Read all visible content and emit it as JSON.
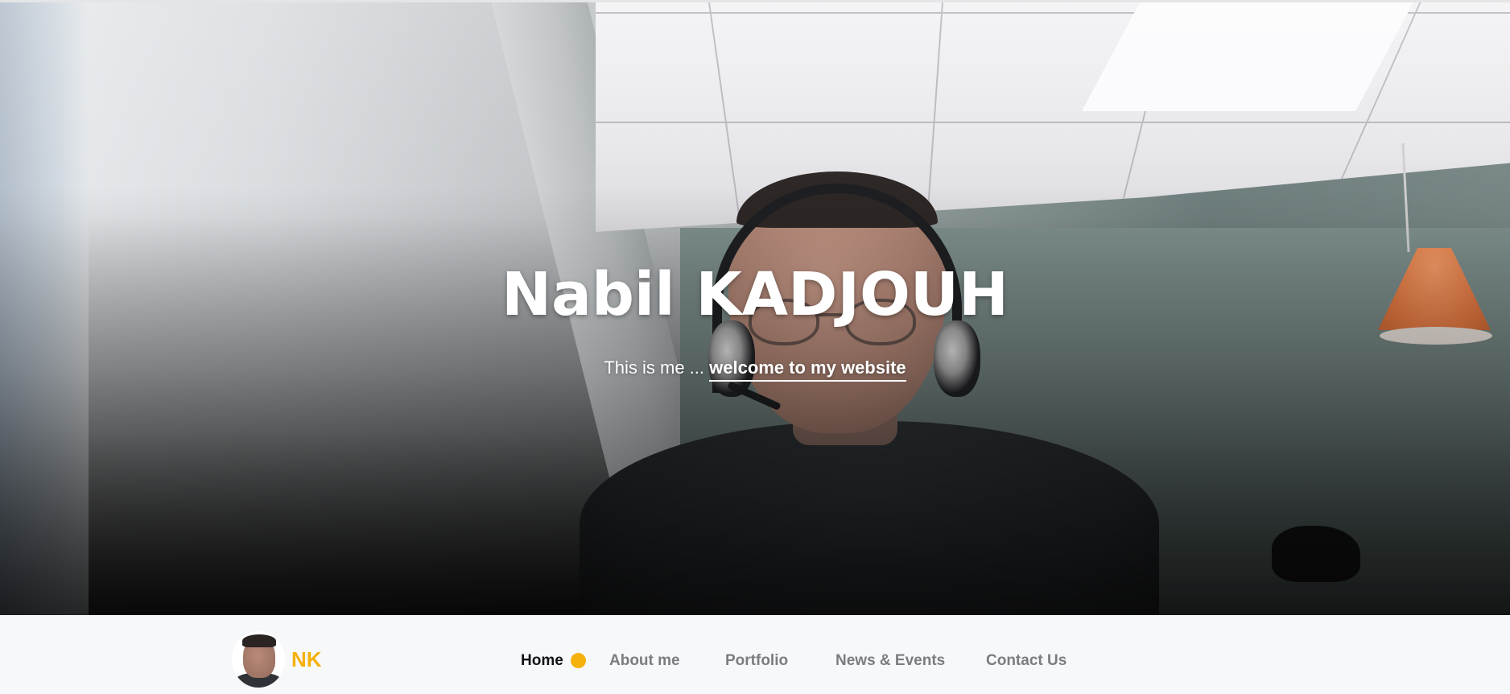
{
  "hero": {
    "title": "Nabil KADJOUH",
    "subtitle_prefix": "This is me ... ",
    "subtitle_link": "welcome to my website"
  },
  "navbar": {
    "brand_initials": "NK",
    "brand_color": "#f5b10c",
    "links": [
      {
        "label": "Home",
        "active": true
      },
      {
        "label": "About me",
        "active": false
      },
      {
        "label": "Portfolio",
        "active": false
      },
      {
        "label": "News & Events",
        "active": false
      },
      {
        "label": "Contact Us",
        "active": false
      }
    ],
    "active_indicator_color": "#f5b10c"
  }
}
